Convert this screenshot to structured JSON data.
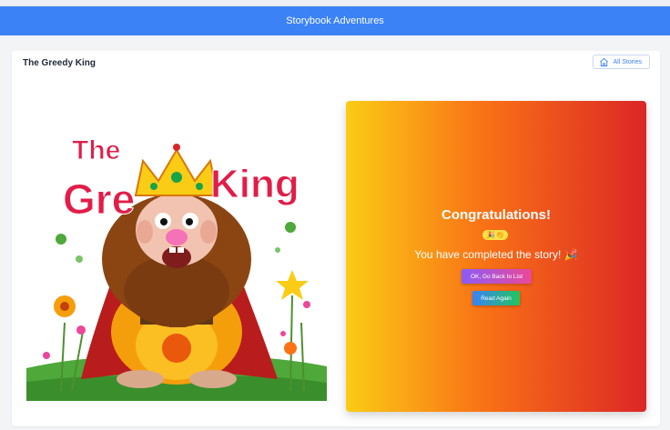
{
  "app": {
    "title": "Storybook Adventures"
  },
  "story": {
    "title": "The Greedy King",
    "all_stories_label": "All Stories",
    "cover_text": {
      "line1": "The",
      "line2a": "Gre",
      "line2b": "King"
    }
  },
  "completion": {
    "heading": "Congratulations!",
    "emoji": "🎉👏",
    "message": "You have completed the story! 🎉",
    "back_button": "OK, Go Back to List",
    "read_again_button": "Read Again"
  },
  "colors": {
    "navbar": "#3b82f6",
    "panel_gradient": [
      "#facc15",
      "#f97316",
      "#dc2626"
    ],
    "back_button_gradient": [
      "#8b5cf6",
      "#ec4899"
    ],
    "read_again_gradient": [
      "#3b82f6",
      "#22c55e"
    ],
    "cover_title": "#e11d48"
  },
  "icons": {
    "all_stories": "home-icon"
  }
}
